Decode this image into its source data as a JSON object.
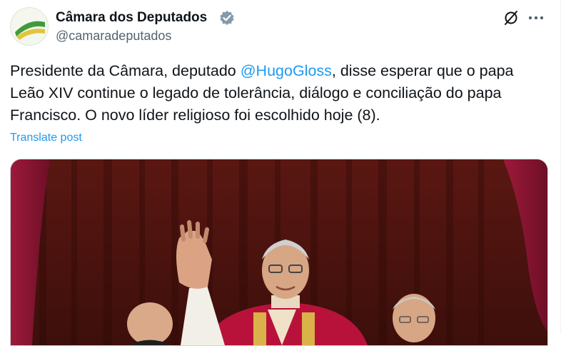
{
  "post": {
    "author_name": "Câmara dos Deputados",
    "handle": "@camaradeputados",
    "text_before_mention": "Presidente da Câmara, deputado ",
    "mention": "@HugoGloss",
    "text_line1_rest": ", disse esperar que o papa",
    "text_line2": "Leão XIV continue o legado de tolerância, diálogo e conciliação do papa",
    "text_line3": "Francisco. O novo líder religioso foi escolhido hoje (8).",
    "translate_label": "Translate post"
  },
  "icons": {
    "verified": "verified-badge-icon",
    "grok": "grok-icon",
    "more": "more-options-icon"
  },
  "colors": {
    "link": "#1d9bf0",
    "text": "#0f1419",
    "secondary": "#536471"
  }
}
